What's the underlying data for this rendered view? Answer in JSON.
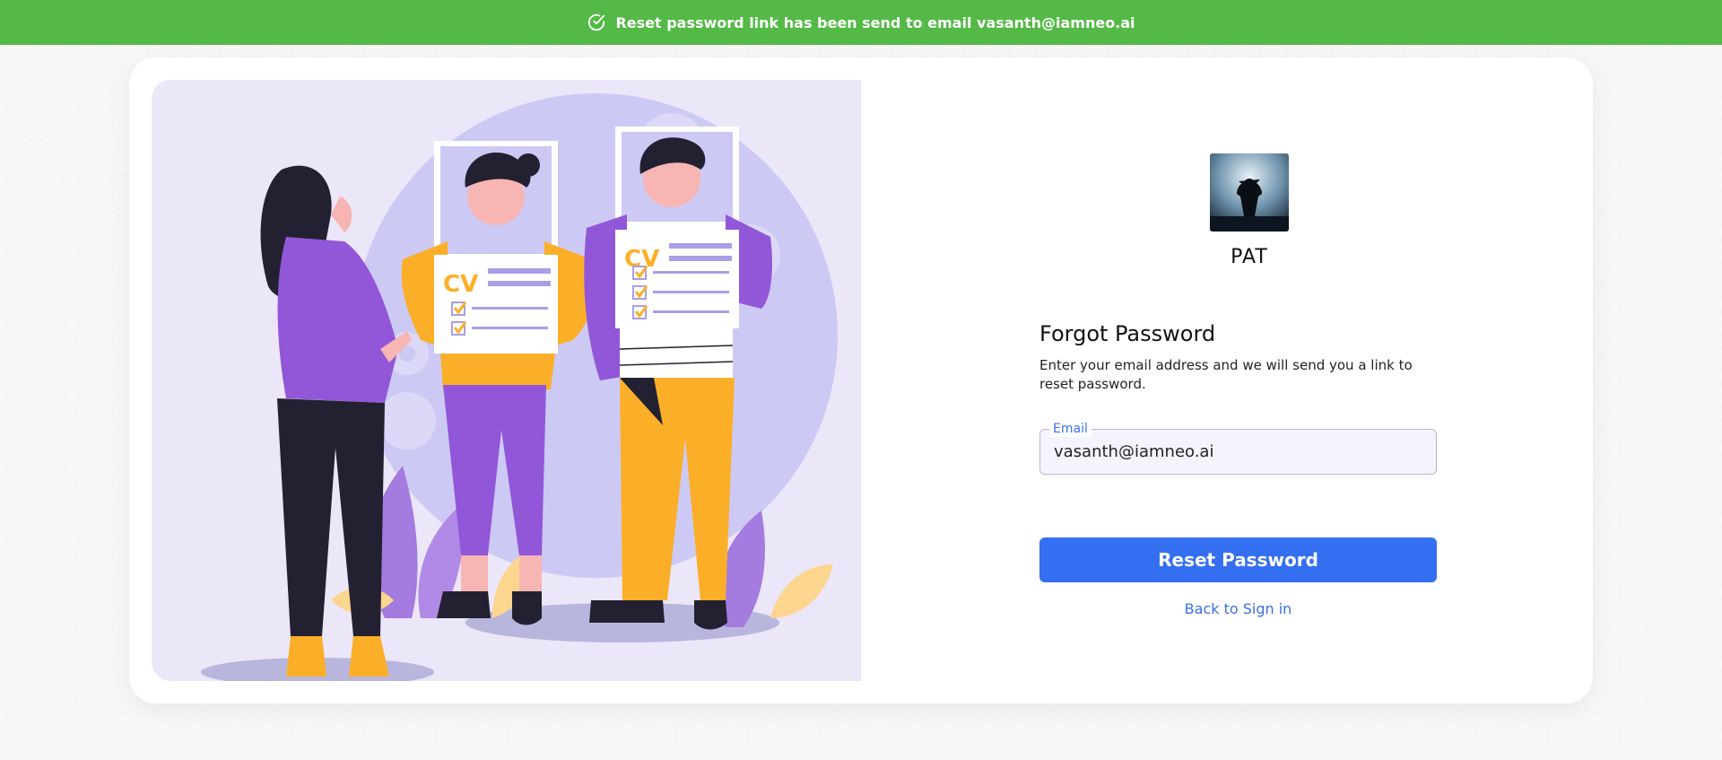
{
  "toast": {
    "message": "Reset password link has been send to email vasanth@iamneo.ai",
    "color": "#54b947"
  },
  "brand": {
    "name": "PAT"
  },
  "form": {
    "title": "Forgot Password",
    "description": "Enter your email address and we will send you a link to reset password.",
    "email_label": "Email",
    "email_value": "vasanth@iamneo.ai",
    "submit_label": "Reset Password",
    "back_link": "Back to Sign in"
  },
  "colors": {
    "primary": "#336ff0",
    "link": "#3b6ee6",
    "illustration_bg": "#ece6f9",
    "purple": "#9257d8",
    "orange": "#fbaf28"
  },
  "icons": {
    "toast": "check-circle-icon"
  }
}
